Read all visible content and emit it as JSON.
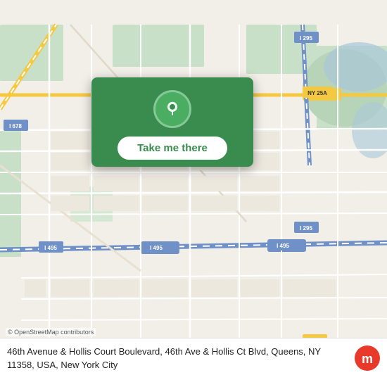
{
  "map": {
    "attribution": "© OpenStreetMap contributors"
  },
  "popup": {
    "button_label": "Take me there"
  },
  "address": {
    "text": "46th Avenue & Hollis Court Boulevard, 46th Ave & Hollis Ct Blvd, Queens, NY 11358, USA, New York City"
  },
  "moovit": {
    "logo_text": "moovit"
  },
  "icons": {
    "pin": "📍",
    "circle": "⬤"
  }
}
